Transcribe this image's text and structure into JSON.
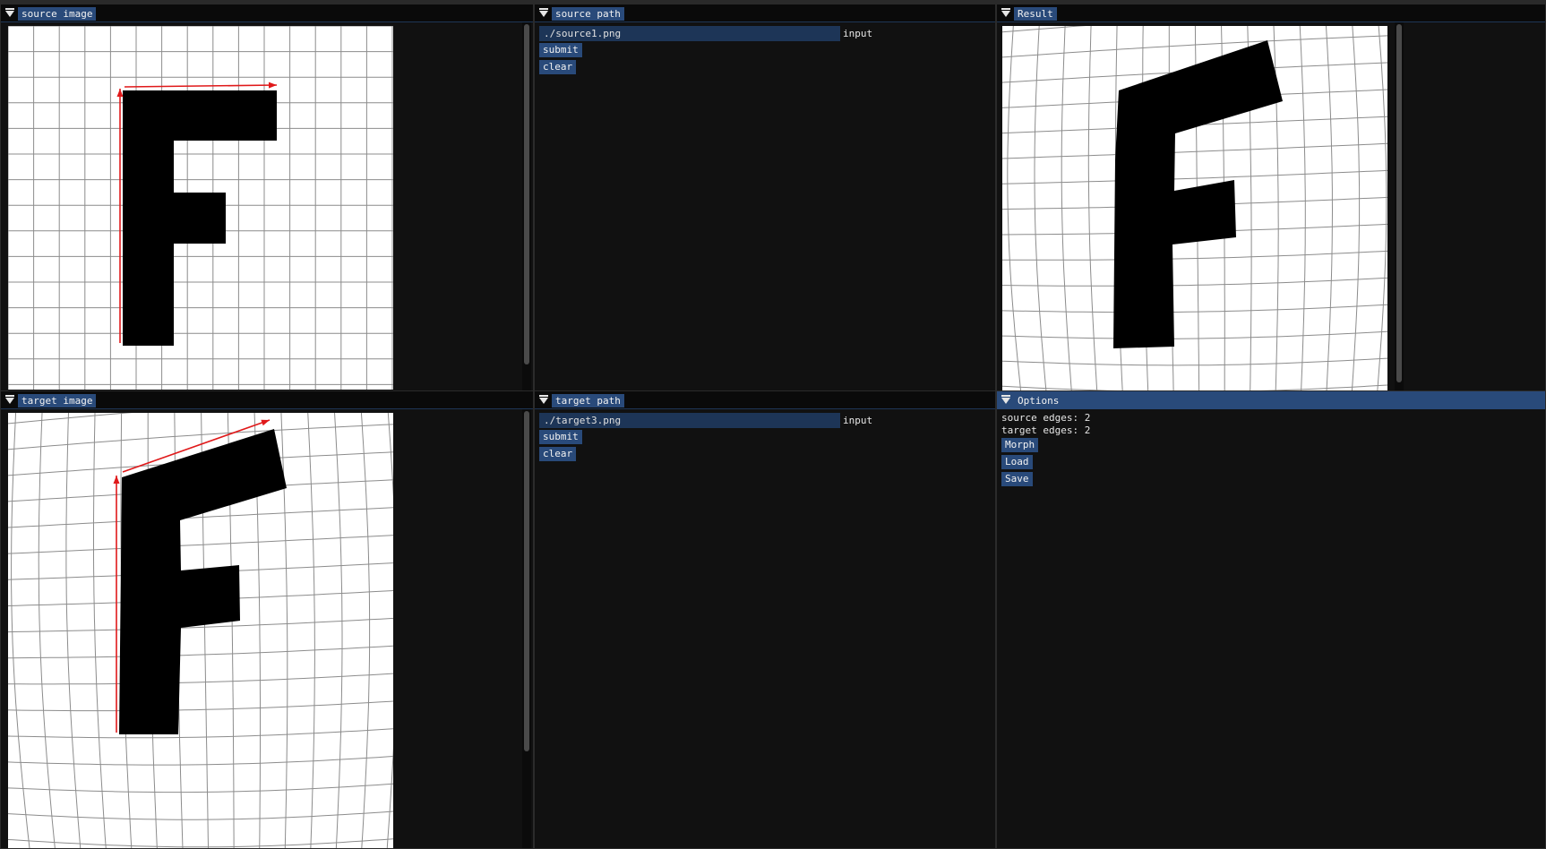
{
  "panels": {
    "source_image": {
      "title": "source image"
    },
    "source_path": {
      "title": "source path",
      "path_value": "./source1.png",
      "input_label": "input",
      "submit_label": "submit",
      "clear_label": "clear"
    },
    "result": {
      "title": "Result"
    },
    "target_image": {
      "title": "target image"
    },
    "target_path": {
      "title": "target path",
      "path_value": "./target3.png",
      "input_label": "input",
      "submit_label": "submit",
      "clear_label": "clear"
    },
    "options": {
      "title": "Options",
      "source_edges": "source edges: 2",
      "target_edges": "target edges: 2",
      "morph_label": "Morph",
      "load_label": "Load",
      "save_label": "Save"
    }
  },
  "colors": {
    "accent": "#294a7a",
    "field_bg": "#1d3557",
    "panel_bg": "#111111",
    "edge_arrow": "#e0191a",
    "grid_line": "#8c8c8c",
    "letter_fill": "#000000"
  },
  "icons": {
    "collapse": "triangle-down-icon"
  }
}
